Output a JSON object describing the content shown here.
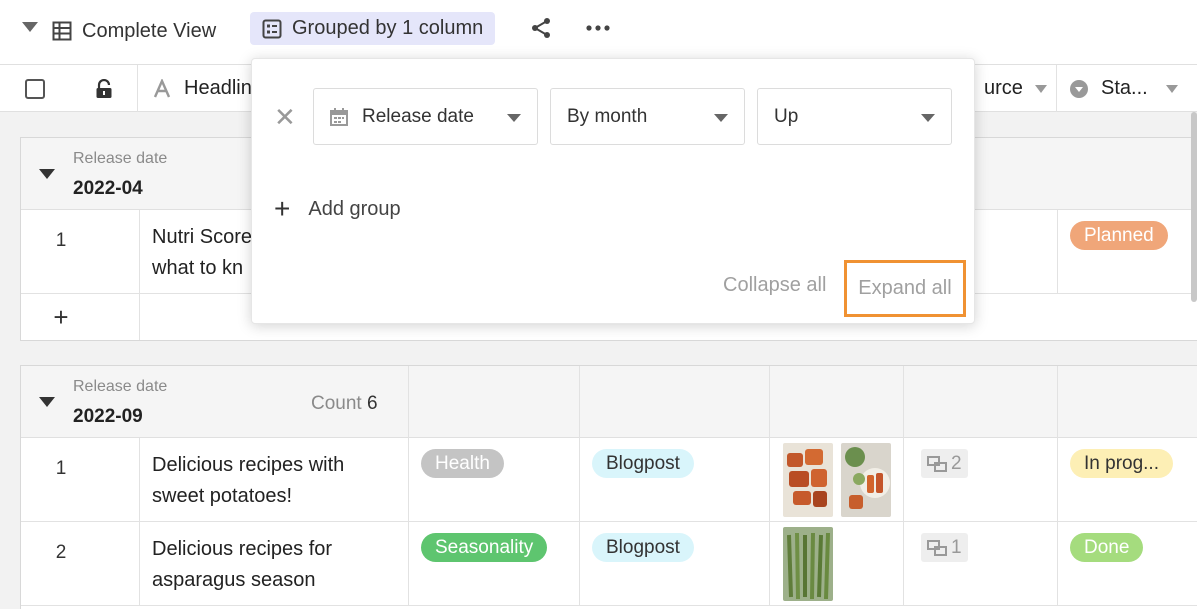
{
  "toolbar": {
    "view_name": "Complete View",
    "grouped_label": "Grouped by 1 column"
  },
  "header": {
    "headline": "Headlin",
    "source": "urce",
    "status": "Sta..."
  },
  "groups": [
    {
      "label": "Release date",
      "value": "2022-04",
      "rows": [
        {
          "num": "1",
          "headline": "Nutri Score what to kn",
          "status": "Planned"
        }
      ],
      "add_row": "+"
    },
    {
      "label": "Release date",
      "value": "2022-09",
      "count_label": "Count",
      "count_value": "6",
      "rows": [
        {
          "num": "1",
          "headline": "Delicious recipes with sweet potatoes!",
          "category": "Health",
          "type": "Blogpost",
          "links": "2",
          "status": "In prog..."
        },
        {
          "num": "2",
          "headline": "Delicious recipes for asparagus season",
          "category": "Seasonality",
          "type": "Blogpost",
          "links": "1",
          "status": "Done"
        }
      ]
    }
  ],
  "popup": {
    "field": "Release date",
    "granularity": "By month",
    "order": "Up",
    "add_group": "Add group",
    "collapse_all": "Collapse all",
    "expand_all": "Expand all"
  },
  "colors": {
    "planned": "#f0a679",
    "health": "#c4c4c4",
    "blogpost": "#d9f5fb",
    "seasonality": "#5ec56f",
    "in_progress": "#fdefb5",
    "done": "#a5dc7e",
    "highlight": "#f09232",
    "grouped_bg": "#e5e6fa"
  },
  "icons": [
    "table-icon",
    "group-icon",
    "share-icon",
    "more-icon",
    "lock-icon",
    "text-type-icon",
    "status-type-icon",
    "calendar-icon",
    "link-icon",
    "close-icon",
    "plus-icon"
  ]
}
